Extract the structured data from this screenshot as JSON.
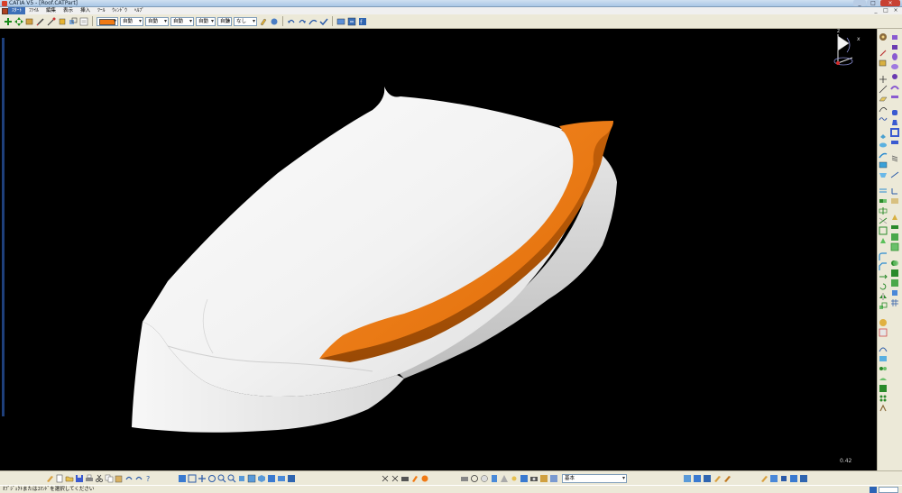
{
  "window": {
    "title": "CATIA V5 - [Roof.CATPart]",
    "controls": [
      "_",
      "□",
      "×"
    ]
  },
  "menu": {
    "items": [
      {
        "label": "ｽﾀｰﾄ",
        "active": true
      },
      {
        "label": "ﾌｧｲﾙ"
      },
      {
        "label": "編集"
      },
      {
        "label": "表示"
      },
      {
        "label": "挿入"
      },
      {
        "label": "ﾂｰﾙ"
      },
      {
        "label": "ｳｨﾝﾄﾞｳ"
      },
      {
        "label": "ﾍﾙﾌﾟ"
      }
    ],
    "right_controls": [
      "_",
      "□",
      "×"
    ]
  },
  "properties_toolbar": {
    "fill_color": "#f07a14",
    "transparency": "自動",
    "line_thickness": "自動",
    "line_type": "自動",
    "point_symbol": "自動",
    "rendering_style": "自動",
    "layer": "なし"
  },
  "viewport": {
    "background": "#000000",
    "zoom_level": "0.42",
    "model": {
      "body_color": "#f4f4f4",
      "spoiler_color": "#f07a14"
    }
  },
  "compass": {
    "z_label": "z",
    "x_label": "x"
  },
  "bottom_toolbar": {
    "layer_combo": "基本"
  },
  "status": {
    "message": "ｵﾌﾞｼﾞｪｸﾄまたはｺﾏﾝﾄﾞを選択してください"
  }
}
